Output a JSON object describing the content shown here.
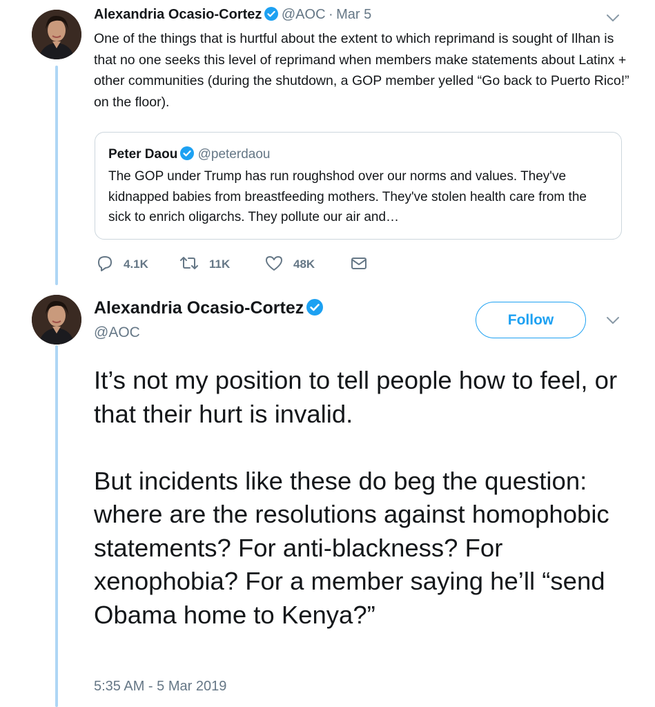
{
  "tweet1": {
    "author_name": "Alexandria Ocasio-Cortez",
    "handle": "@AOC",
    "separator": "·",
    "date": "Mar 5",
    "text": "One of the things that is hurtful about the extent to which reprimand is sought of Ilhan is that no one seeks this level of reprimand when members make statements about Latinx + other communities (during the shutdown, a GOP member yelled “Go back to Puerto Rico!” on the floor).",
    "quote": {
      "author_name": "Peter Daou",
      "handle": "@peterdaou",
      "text": "The GOP under Trump has run roughshod over our norms and values. They've kidnapped babies from breastfeeding mothers. They've stolen health care from the sick to enrich oligarchs. They pollute our air and…"
    },
    "actions": {
      "replies": "4.1K",
      "retweets": "11K",
      "likes": "48K"
    }
  },
  "tweet2": {
    "author_name": "Alexandria Ocasio-Cortez",
    "handle": "@AOC",
    "follow_label": "Follow",
    "paragraph1": "It’s not my position to tell people how to feel, or that their hurt is invalid.",
    "paragraph2": "But incidents like these do beg the question: where are the resolutions against homophobic statements? For anti-blackness? For xenophobia? For a member saying he’ll “send Obama home to Kenya?”",
    "timestamp": "5:35 AM - 5 Mar 2019"
  },
  "icons": [
    "verified-badge-icon",
    "chevron-down-icon",
    "reply-icon",
    "retweet-icon",
    "like-icon",
    "direct-message-icon"
  ],
  "colors": {
    "accent": "#1da1f2",
    "muted_text": "#657786",
    "thread_line": "#aed6f5",
    "border": "#ccd6dd"
  }
}
